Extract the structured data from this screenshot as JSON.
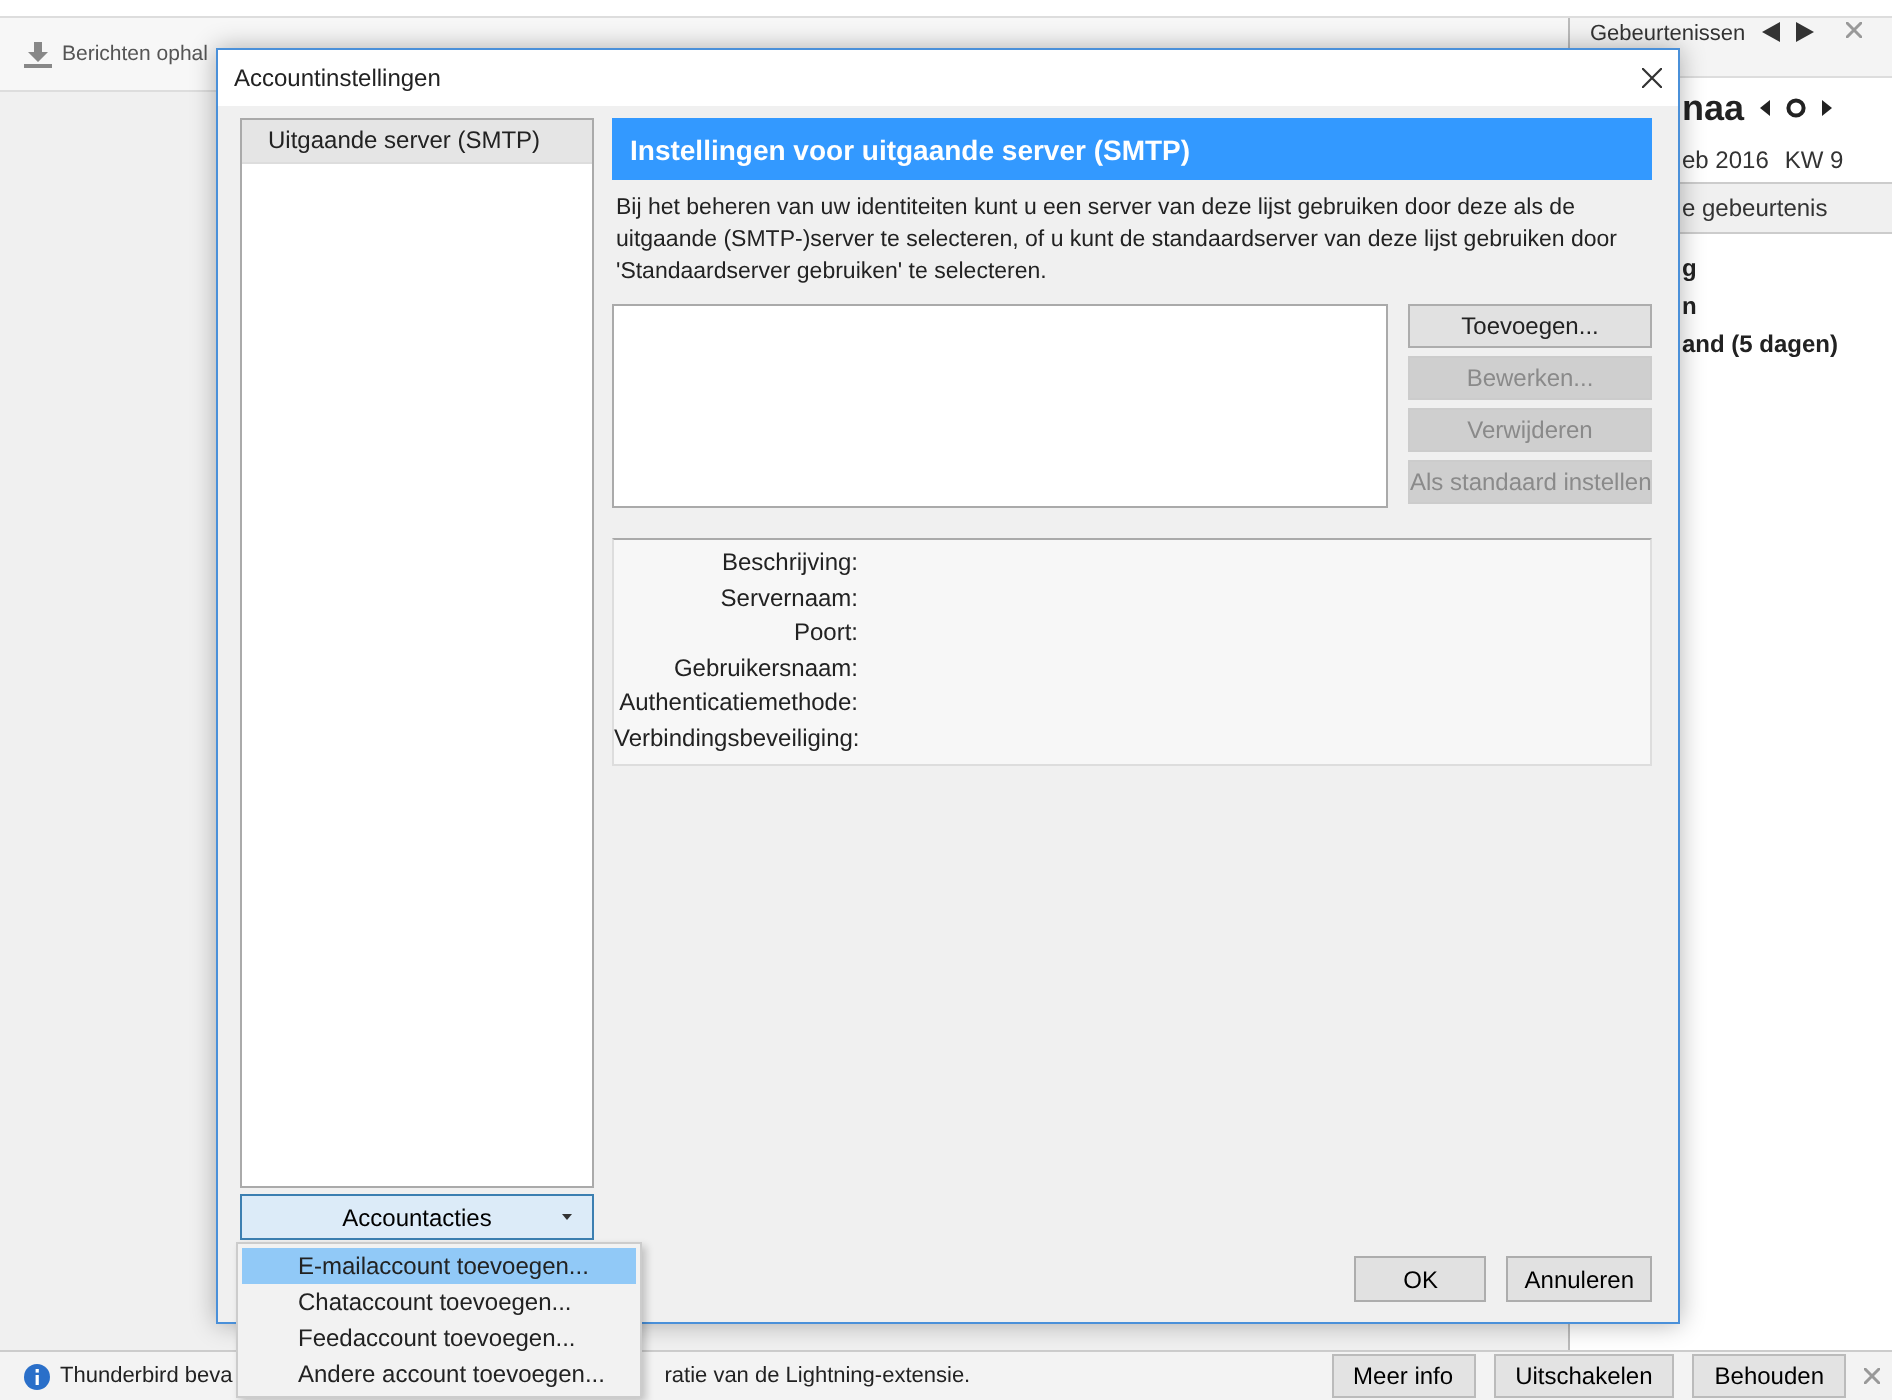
{
  "main_window": {
    "toolbar": {
      "get_messages": "Berichten ophal"
    },
    "events_pane": {
      "title": "Gebeurtenissen",
      "month": "naa",
      "date": "eb 2016",
      "week": "KW 9",
      "new_event": "e gebeurtenis",
      "entries": [
        {
          "text": "g"
        },
        {
          "text": "n"
        },
        {
          "text": "and (5 dagen)"
        }
      ]
    },
    "notification": {
      "text_before": "Thunderbird beva",
      "text_after": "ratie van de Lightning-extensie.",
      "buttons": [
        {
          "label": "Meer info"
        },
        {
          "label": "Uitschakelen"
        },
        {
          "label": "Behouden"
        }
      ]
    }
  },
  "dialog": {
    "title": "Accountinstellingen",
    "account_tree": [
      {
        "label": "Uitgaande server (SMTP)",
        "selected": true
      }
    ],
    "account_actions": "Accountacties",
    "page_title": "Instellingen voor uitgaande server (SMTP)",
    "description": "Bij het beheren van uw identiteiten kunt u een server van deze lijst gebruiken door deze als de uitgaande (SMTP-)server te selecteren, of u kunt de standaardserver van deze lijst gebruiken door 'Standaardserver gebruiken' te selecteren.",
    "server_buttons": [
      {
        "label": "Toevoegen...",
        "disabled": false
      },
      {
        "label": "Bewerken...",
        "disabled": true
      },
      {
        "label": "Verwijderen",
        "disabled": true
      },
      {
        "label": "Als standaard instellen",
        "disabled": true
      }
    ],
    "details": [
      {
        "label": "Beschrijving:"
      },
      {
        "label": "Servernaam:"
      },
      {
        "label": "Poort:"
      },
      {
        "label": "Gebruikersnaam:"
      },
      {
        "label": "Authenticatiemethode:"
      },
      {
        "label": "Verbindingsbeveiliging:"
      }
    ],
    "footer_buttons": [
      {
        "label": "OK"
      },
      {
        "label": "Annuleren"
      }
    ]
  },
  "account_actions_menu": {
    "items": [
      {
        "label": "E-mailaccount toevoegen...",
        "selected": true
      },
      {
        "label": "Chataccount toevoegen...",
        "selected": false
      },
      {
        "label": "Feedaccount toevoegen...",
        "selected": false
      },
      {
        "label": "Andere account toevoegen...",
        "selected": false
      }
    ]
  }
}
